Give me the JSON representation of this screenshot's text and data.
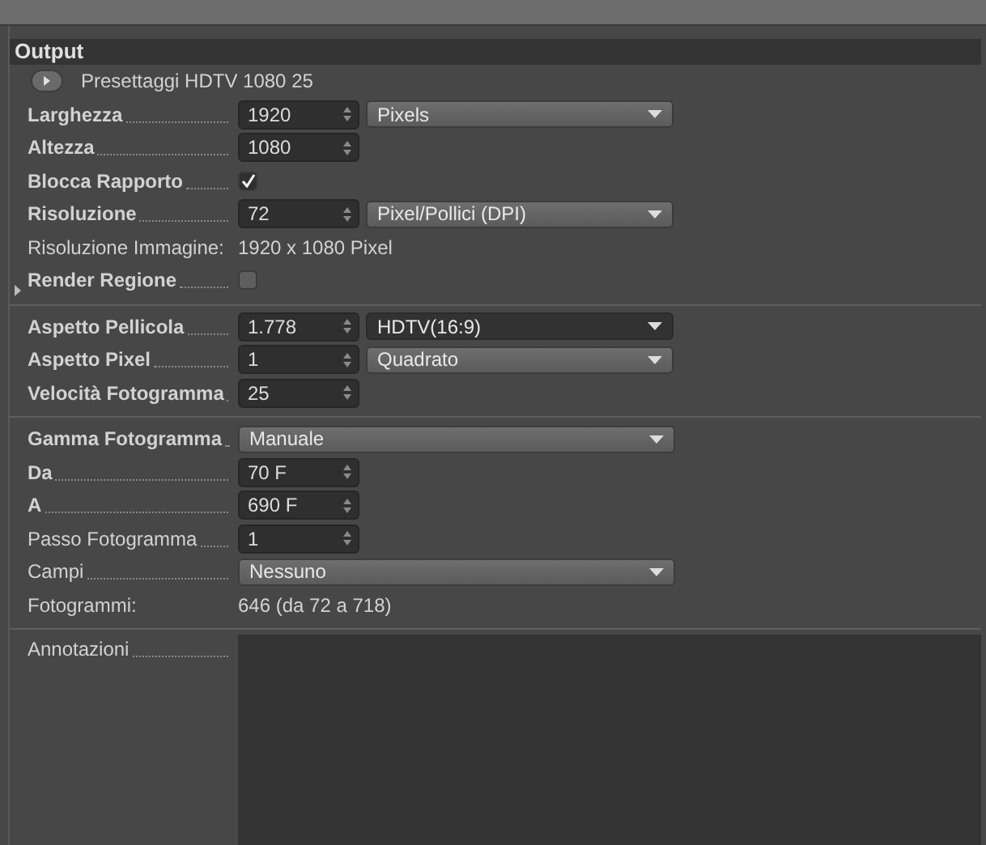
{
  "panel": {
    "title": "Output"
  },
  "preset": {
    "label": "Presettaggi HDTV 1080 25"
  },
  "sections": [
    {
      "rows": [
        {
          "kind": "spin",
          "label": "Larghezza",
          "bold": true,
          "value": "1920",
          "dropdown": {
            "value": "Pixels",
            "focused": false
          }
        },
        {
          "kind": "spin",
          "label": "Altezza",
          "bold": true,
          "value": "1080"
        },
        {
          "kind": "checkbox",
          "label": "Blocca Rapporto",
          "bold": true,
          "checked": true
        },
        {
          "kind": "spin",
          "label": "Risoluzione",
          "bold": true,
          "value": "72",
          "dropdown": {
            "value": "Pixel/Pollici (DPI)",
            "focused": false
          }
        },
        {
          "kind": "info",
          "label": "Risoluzione Immagine:",
          "bold": false,
          "value": "1920 x 1080 Pixel"
        },
        {
          "kind": "checkbox",
          "label": "Render Regione",
          "bold": true,
          "checked": false,
          "expanded": false
        }
      ]
    },
    {
      "rows": [
        {
          "kind": "spin",
          "label": "Aspetto Pellicola",
          "bold": true,
          "value": "1.778",
          "dropdown": {
            "value": "HDTV(16:9)",
            "focused": true
          }
        },
        {
          "kind": "spin",
          "label": "Aspetto Pixel",
          "bold": true,
          "value": "1",
          "dropdown": {
            "value": "Quadrato",
            "focused": false
          }
        },
        {
          "kind": "spin",
          "label": "Velocità Fotogramma",
          "bold": true,
          "value": "25"
        }
      ]
    },
    {
      "rows": [
        {
          "kind": "dropdown",
          "label": "Gamma Fotogramma",
          "bold": true,
          "dropdown": {
            "value": "Manuale",
            "focused": false
          }
        },
        {
          "kind": "spin",
          "label": "Da",
          "bold": true,
          "value": "70 F"
        },
        {
          "kind": "spin",
          "label": "A",
          "bold": true,
          "value": "690 F"
        },
        {
          "kind": "spin",
          "label": "Passo Fotogramma",
          "bold": false,
          "value": "1"
        },
        {
          "kind": "dropdown",
          "label": "Campi",
          "bold": false,
          "dropdown": {
            "value": "Nessuno",
            "focused": false
          }
        },
        {
          "kind": "info",
          "label": "Fotogrammi:",
          "bold": false,
          "value": "646 (da 72 a 718)"
        }
      ]
    }
  ],
  "notes": {
    "label": "Annotazioni"
  }
}
